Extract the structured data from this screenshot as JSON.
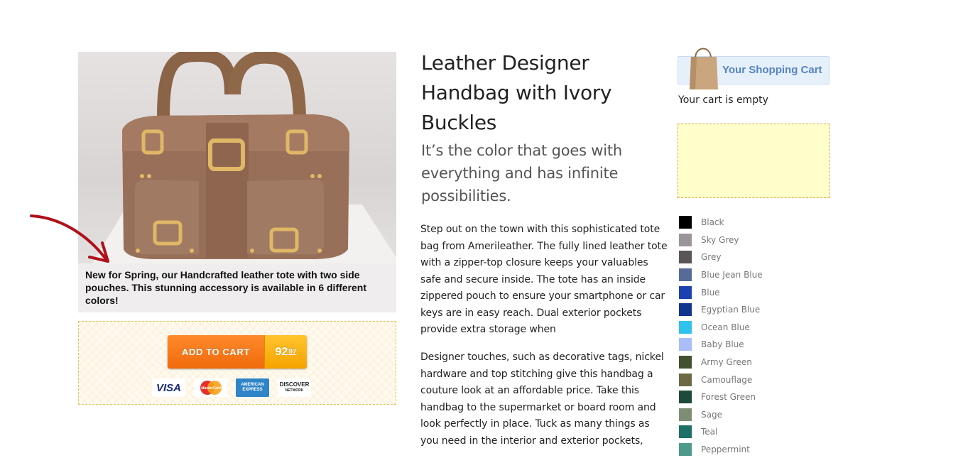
{
  "product": {
    "title": "Leather Designer Handbag with Ivory Buckles",
    "tagline": "It’s the color that goes with everything and has infinite possibilities.",
    "caption": "New for Spring, our Handcrafted leather tote with two side pouches. This stunning accessory is available in 6 different colors!",
    "description_1": "Step out on the town with this sophisticated tote bag from Amerileather. The fully lined leather tote with a zipper-top closure keeps your valuables safe and secure inside. The tote has an inside zippered pouch to ensure your smartphone or car keys are in easy reach. Dual exterior pockets provide extra storage when",
    "description_2": "Designer touches, such as decorative tags, nickel hardware and top stitching give this handbag a couture look at an affordable price. Take this handbag to the supermarket or board room and look perfectly in place. Tuck as many things as you need in the interior and exterior pockets,"
  },
  "buy": {
    "add_to_cart_label": "ADD TO CART",
    "price_dollars": "92",
    "price_cents": "97",
    "cards": {
      "visa": "VISA",
      "mastercard": "MasterCard",
      "amex": "AMERICAN EXPRESS",
      "discover": "DISCOVER",
      "discover_sub": "NETWORK"
    }
  },
  "cart": {
    "header_label": "Your Shopping Cart",
    "empty_text": "Your cart is empty"
  },
  "colors": [
    {
      "name": "Black",
      "hex": "#000000"
    },
    {
      "name": "Sky Grey",
      "hex": "#9c949b"
    },
    {
      "name": "Grey",
      "hex": "#5a5658"
    },
    {
      "name": "Blue Jean Blue",
      "hex": "#566b98"
    },
    {
      "name": "Blue",
      "hex": "#1c42b2"
    },
    {
      "name": "Egyptian Blue",
      "hex": "#12358f"
    },
    {
      "name": "Ocean Blue",
      "hex": "#2ec2ec"
    },
    {
      "name": "Baby Blue",
      "hex": "#a9bdfa"
    },
    {
      "name": "Army Green",
      "hex": "#42512f"
    },
    {
      "name": "Camouflage",
      "hex": "#6b6a45"
    },
    {
      "name": "Forest Green",
      "hex": "#1e4a3a"
    },
    {
      "name": "Sage",
      "hex": "#7e8e74"
    },
    {
      "name": "Teal",
      "hex": "#1e6f67"
    },
    {
      "name": "Peppermint",
      "hex": "#4d9a8a"
    }
  ]
}
